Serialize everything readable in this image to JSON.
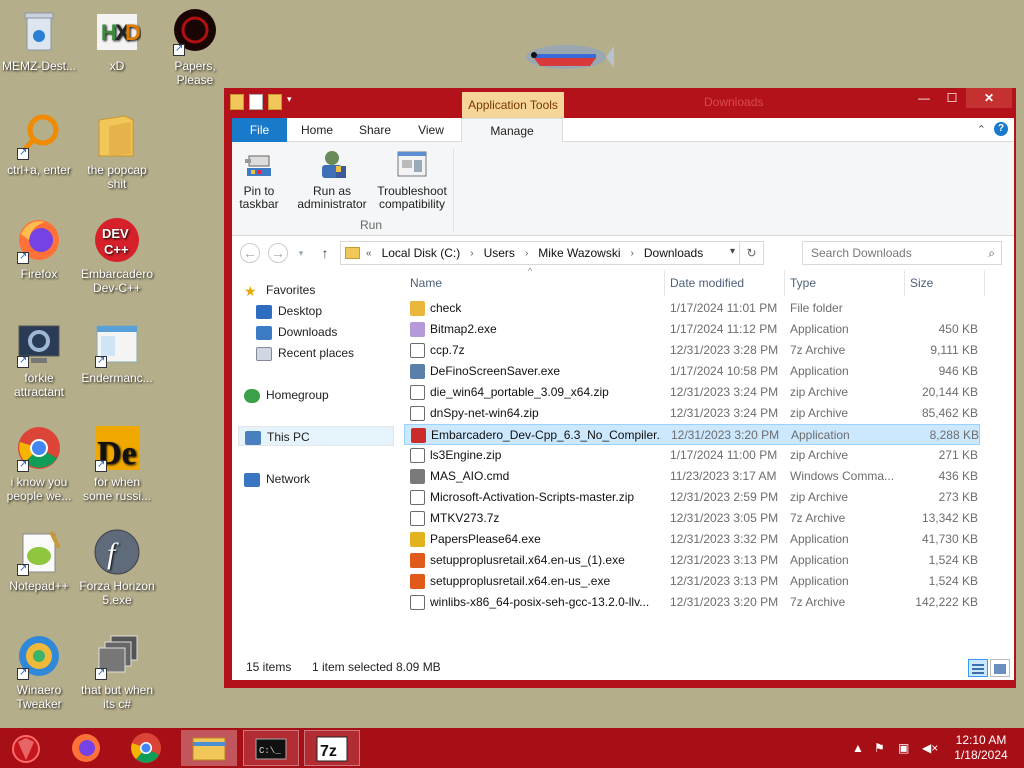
{
  "desktop": {
    "icons": [
      {
        "label": "MEMZ-Dest...",
        "icon": "recycle-bin-icon"
      },
      {
        "label": "xD",
        "icon": "hxd-icon"
      },
      {
        "label": "Papers, Please",
        "icon": "papers-please-icon"
      },
      {
        "label": "ctrl+a, enter",
        "icon": "magnifier-icon"
      },
      {
        "label": "the popcap shit",
        "icon": "folder-icon"
      },
      {
        "label": "Firefox",
        "icon": "firefox-icon"
      },
      {
        "label": "Embarcadero Dev-C++",
        "icon": "devcpp-icon"
      },
      {
        "label": "forkie attractant",
        "icon": "settings-monitor-icon"
      },
      {
        "label": "Endermanc...",
        "icon": "window-app-icon"
      },
      {
        "label": "i know you people we...",
        "icon": "chrome-icon"
      },
      {
        "label": "for when some russi...",
        "icon": "de-icon"
      },
      {
        "label": "Notepad++",
        "icon": "notepadpp-icon"
      },
      {
        "label": "Forza Horizon 5.exe",
        "icon": "flash-icon"
      },
      {
        "label": "Winaero Tweaker",
        "icon": "winaero-icon"
      },
      {
        "label": "that but when its c#",
        "icon": "windows-stack-icon"
      }
    ]
  },
  "window": {
    "title": "Downloads",
    "context_tab": "Application Tools",
    "close_label": "✕",
    "min_label": "—",
    "max_label": "☐"
  },
  "ribbon": {
    "tabs": [
      "File",
      "Home",
      "Share",
      "View",
      "Manage"
    ],
    "buttons": {
      "pin": "Pin to taskbar",
      "runas": "Run as administrator",
      "troubleshoot": "Troubleshoot compatibility"
    },
    "group_label": "Run"
  },
  "address": {
    "crumbs": [
      "Local Disk (C:)",
      "Users",
      "Mike Wazowski",
      "Downloads"
    ],
    "prefix": "«",
    "search_placeholder": "Search Downloads"
  },
  "navpane": {
    "favorites": "Favorites",
    "desktop": "Desktop",
    "downloads": "Downloads",
    "recent": "Recent places",
    "homegroup": "Homegroup",
    "thispc": "This PC",
    "network": "Network"
  },
  "columns": [
    "Name",
    "Date modified",
    "Type",
    "Size"
  ],
  "files": [
    {
      "name": "check",
      "date": "1/17/2024 11:01 PM",
      "type": "File folder",
      "size": "",
      "icon": "folder",
      "color": "#e8b73c"
    },
    {
      "name": "Bitmap2.exe",
      "date": "1/17/2024 11:12 PM",
      "type": "Application",
      "size": "450 KB",
      "icon": "app",
      "color": "#b49ad8"
    },
    {
      "name": "ccp.7z",
      "date": "12/31/2023 3:28 PM",
      "type": "7z Archive",
      "size": "9,111 KB",
      "icon": "archive",
      "color": "#6b6b6b"
    },
    {
      "name": "DeFinoScreenSaver.exe",
      "date": "1/17/2024 10:58 PM",
      "type": "Application",
      "size": "946 KB",
      "icon": "app",
      "color": "#5a7fa8"
    },
    {
      "name": "die_win64_portable_3.09_x64.zip",
      "date": "12/31/2023 3:24 PM",
      "type": "zip Archive",
      "size": "20,144 KB",
      "icon": "archive",
      "color": "#6b6b6b"
    },
    {
      "name": "dnSpy-net-win64.zip",
      "date": "12/31/2023 3:24 PM",
      "type": "zip Archive",
      "size": "85,462 KB",
      "icon": "archive",
      "color": "#6b6b6b"
    },
    {
      "name": "Embarcadero_Dev-Cpp_6.3_No_Compiler...",
      "date": "12/31/2023 3:20 PM",
      "type": "Application",
      "size": "8,288 KB",
      "icon": "app",
      "color": "#cc2b2b"
    },
    {
      "name": "ls3Engine.zip",
      "date": "1/17/2024 11:00 PM",
      "type": "zip Archive",
      "size": "271 KB",
      "icon": "archive",
      "color": "#6b6b6b"
    },
    {
      "name": "MAS_AIO.cmd",
      "date": "11/23/2023 3:17 AM",
      "type": "Windows Comma...",
      "size": "436 KB",
      "icon": "cmd",
      "color": "#7a7a7a"
    },
    {
      "name": "Microsoft-Activation-Scripts-master.zip",
      "date": "12/31/2023 2:59 PM",
      "type": "zip Archive",
      "size": "273 KB",
      "icon": "archive",
      "color": "#6b6b6b"
    },
    {
      "name": "MTKV273.7z",
      "date": "12/31/2023 3:05 PM",
      "type": "7z Archive",
      "size": "13,342 KB",
      "icon": "archive",
      "color": "#6b6b6b"
    },
    {
      "name": "PapersPlease64.exe",
      "date": "12/31/2023 3:32 PM",
      "type": "Application",
      "size": "41,730 KB",
      "icon": "app",
      "color": "#e3b21f"
    },
    {
      "name": "setupproplusretail.x64.en-us_(1).exe",
      "date": "12/31/2023 3:13 PM",
      "type": "Application",
      "size": "1,524 KB",
      "icon": "office",
      "color": "#e05a1c"
    },
    {
      "name": "setupproplusretail.x64.en-us_.exe",
      "date": "12/31/2023 3:13 PM",
      "type": "Application",
      "size": "1,524 KB",
      "icon": "office",
      "color": "#e05a1c"
    },
    {
      "name": "winlibs-x86_64-posix-seh-gcc-13.2.0-llv...",
      "date": "12/31/2023 3:20 PM",
      "type": "7z Archive",
      "size": "142,222 KB",
      "icon": "archive",
      "color": "#6b6b6b"
    }
  ],
  "selected_index": 6,
  "status": {
    "count": "15 items",
    "selected": "1 item selected",
    "size": "8.09 MB"
  },
  "taskbar": {
    "apps": [
      "start-orb-icon",
      "firefox-icon",
      "chrome-icon",
      "file-explorer-icon",
      "cmd-icon",
      "7zip-icon"
    ],
    "time": "12:10 AM",
    "date": "1/18/2024"
  }
}
